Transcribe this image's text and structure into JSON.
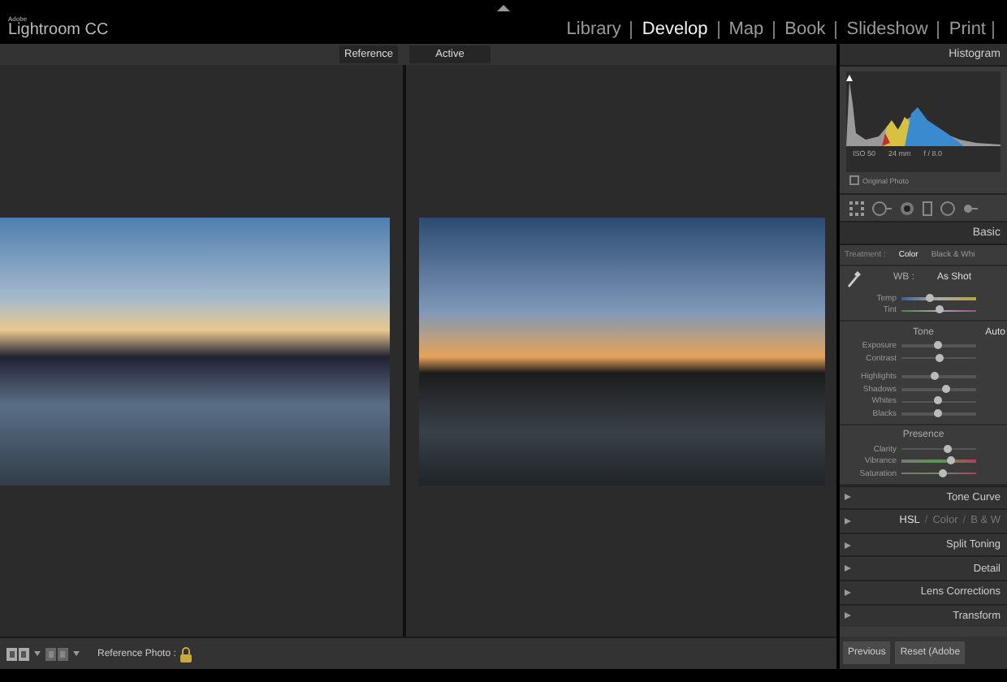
{
  "app": {
    "vendor": "Adobe",
    "name": "Lightroom CC"
  },
  "modules": [
    {
      "label": "Library",
      "selected": false
    },
    {
      "label": "Develop",
      "selected": true
    },
    {
      "label": "Map",
      "selected": false
    },
    {
      "label": "Book",
      "selected": false
    },
    {
      "label": "Slideshow",
      "selected": false
    },
    {
      "label": "Print",
      "selected": false
    }
  ],
  "compare": {
    "reference_label": "Reference",
    "active_label": "Active"
  },
  "toolbar": {
    "reference_label": "Reference Photo :",
    "locked": true
  },
  "histogram": {
    "title": "Histogram",
    "info": [
      "ISO 50",
      "24 mm",
      "f / 8.0"
    ],
    "original_photo": {
      "label": "Original Photo",
      "checked": false
    }
  },
  "basic": {
    "title": "Basic",
    "treatment_label": "Treatment :",
    "treatments": [
      {
        "label": "Color",
        "selected": true
      },
      {
        "label": "Black & Whi",
        "selected": false
      }
    ],
    "wb_label": "WB :",
    "wb_value": "As Shot",
    "wb_sliders": [
      {
        "name": "Temp",
        "kind": "temp",
        "level": 0.4
      },
      {
        "name": "Tint",
        "kind": "tint",
        "level": 0.53
      }
    ],
    "tone_label": "Tone",
    "auto_label": "Auto",
    "tone_sliders": [
      {
        "name": "Exposure",
        "kind": "plain",
        "level": 0.5
      },
      {
        "name": "Contrast",
        "kind": "plain",
        "level": 0.52
      },
      {
        "name": "Highlights",
        "kind": "plain",
        "level": 0.45
      },
      {
        "name": "Shadows",
        "kind": "plain",
        "level": 0.6
      },
      {
        "name": "Whites",
        "kind": "plain",
        "level": 0.5
      },
      {
        "name": "Blacks",
        "kind": "plain",
        "level": 0.5
      }
    ],
    "presence_label": "Presence",
    "presence_sliders": [
      {
        "name": "Clarity",
        "kind": "plain",
        "level": 0.62
      },
      {
        "name": "Vibrance",
        "kind": "color",
        "level": 0.68
      },
      {
        "name": "Saturation",
        "kind": "color",
        "level": 0.57
      }
    ]
  },
  "panels": [
    {
      "kind": "single",
      "title": "Tone Curve"
    },
    {
      "kind": "tabs",
      "separator": "/",
      "parts": [
        {
          "label": "HSL",
          "selected": true
        },
        {
          "label": "Color",
          "selected": false
        },
        {
          "label": "B & W",
          "selected": false
        }
      ]
    },
    {
      "kind": "single",
      "title": "Split Toning"
    },
    {
      "kind": "single",
      "title": "Detail"
    },
    {
      "kind": "single",
      "title": "Lens Corrections"
    },
    {
      "kind": "single",
      "title": "Transform"
    }
  ],
  "buttons": [
    {
      "label": "Previous"
    },
    {
      "label": "Reset (Adobe"
    }
  ]
}
